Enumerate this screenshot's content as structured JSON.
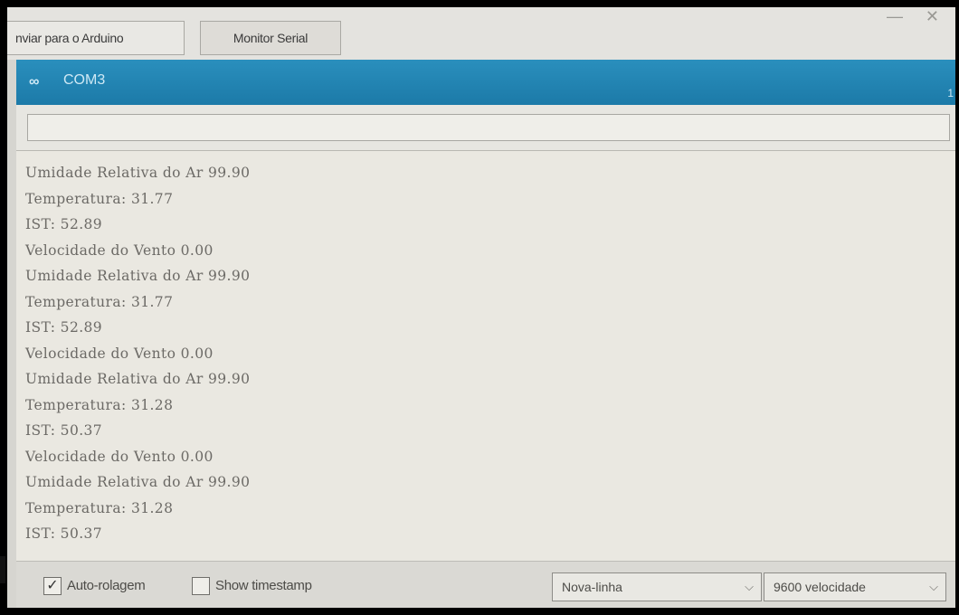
{
  "tabs": [
    "nviar para o Arduino",
    "Monitor Serial"
  ],
  "window": {
    "title": "COM3",
    "logo": "∞",
    "edge_text": "1",
    "controls": [
      "—",
      "✕"
    ]
  },
  "send": {
    "value": ""
  },
  "output_lines": [
    "Umidade Relativa do Ar 99.90",
    "Temperatura: 31.77",
    "IST: 52.89",
    "Velocidade do Vento 0.00",
    "Umidade Relativa do Ar 99.90",
    "Temperatura: 31.77",
    "IST: 52.89",
    "Velocidade do Vento 0.00",
    "Umidade Relativa do Ar 99.90",
    "Temperatura: 31.28",
    "IST: 50.37",
    "Velocidade do Vento 0.00",
    "Umidade Relativa do Ar 99.90",
    "Temperatura: 31.28",
    "IST: 50.37"
  ],
  "footer": {
    "autoscroll": {
      "label": "Auto-rolagem",
      "checked": true,
      "mark": "✓"
    },
    "timestamp": {
      "label": "Show timestamp",
      "checked": false
    },
    "line_ending": {
      "value": "Nova-linha",
      "chevron": "⌵"
    },
    "baud": {
      "value": "9600 velocidade",
      "chevron": "⌵"
    }
  }
}
